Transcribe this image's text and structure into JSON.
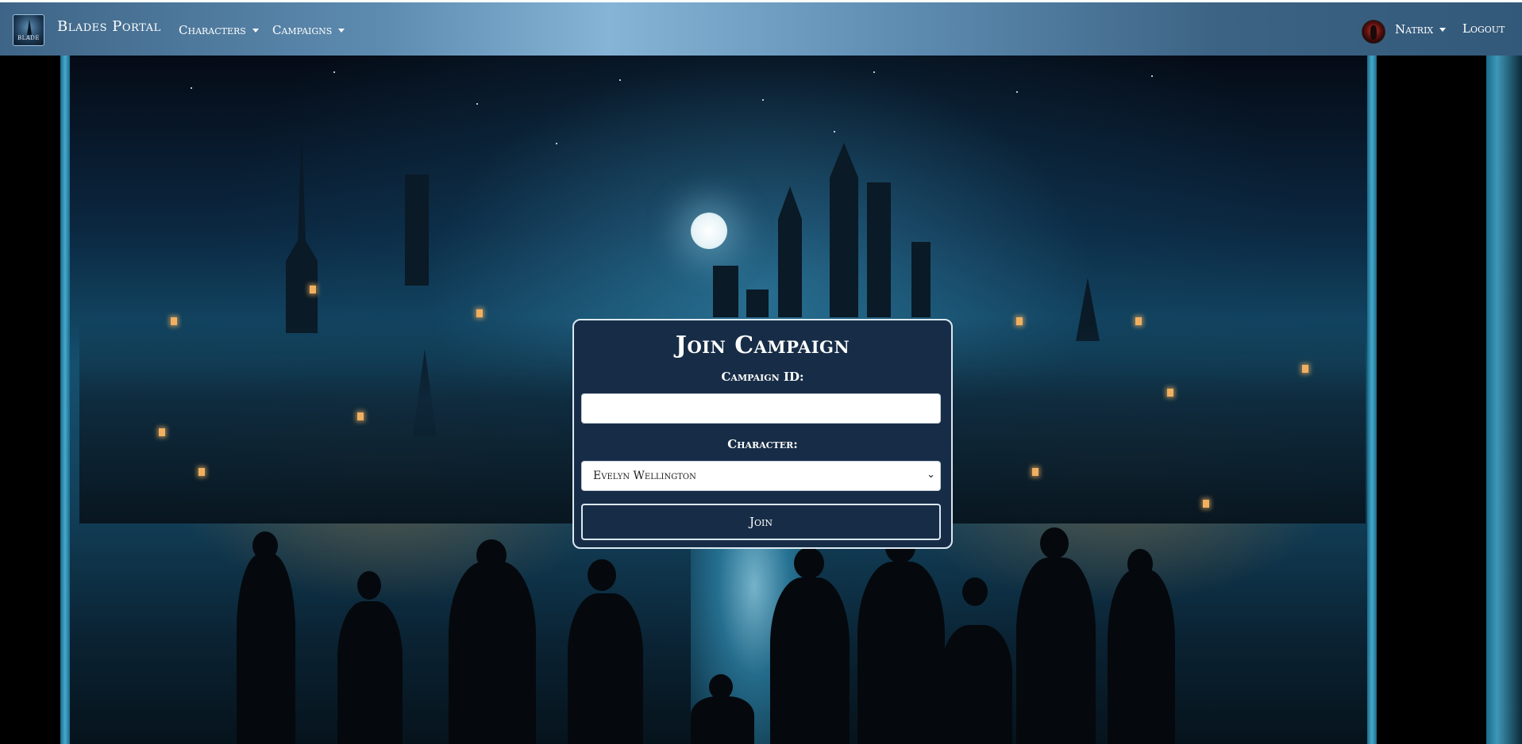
{
  "navbar": {
    "logo_text": "BLADE",
    "brand": "Blades Portal",
    "menus": [
      {
        "label": "Characters"
      },
      {
        "label": "Campaigns"
      }
    ],
    "user": {
      "name": "Natrix"
    },
    "logout_label": "Logout"
  },
  "join_form": {
    "title": "Join Campaign",
    "campaign_id_label": "Campaign ID:",
    "campaign_id_value": "",
    "character_label": "Character:",
    "character_selected": "Evelyn Wellington",
    "join_label": "Join"
  },
  "colors": {
    "navbar": "#5d8bb0",
    "card_bg": "#172d47",
    "card_border": "#dbe8f2"
  }
}
